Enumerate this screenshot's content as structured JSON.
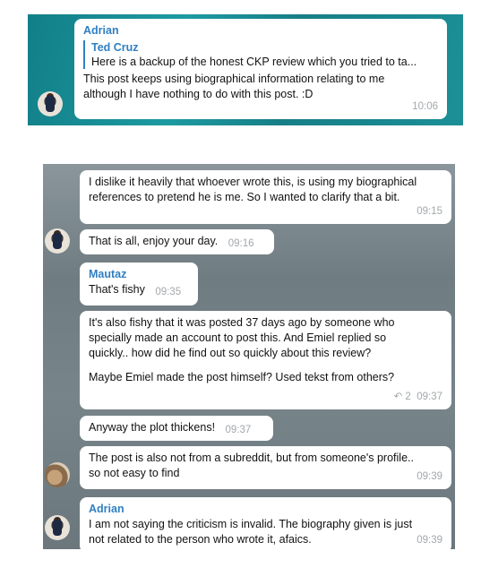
{
  "top": {
    "sender": "Adrian",
    "reply_name": "Ted Cruz",
    "reply_text": "Here is a backup of the honest CKP review which you tried to ta...",
    "text_line1": "This post keeps using biographical information relating to me",
    "text_line2": "although I have nothing to do with this post. :D",
    "time": "10:06"
  },
  "messages": [
    {
      "line1": "I dislike it heavily that whoever wrote this, is using my biographical",
      "line2": "references to pretend he is me. So I wanted to clarify that a bit.",
      "time": "09:15"
    },
    {
      "text": "That is all, enjoy your day.",
      "time": "09:16"
    },
    {
      "sender": "Mautaz",
      "text": "That's fishy",
      "time": "09:35"
    },
    {
      "line1": "It's also fishy that it was posted 37 days ago by someone who",
      "line2": "specially made an account to post this. And Emiel replied so",
      "line3": "quickly.. how did he find out so quickly about this review?",
      "line4": "Maybe Emiel made the post himself? Used tekst from others?",
      "forwards": "2",
      "time": "09:37"
    },
    {
      "text": "Anyway the plot thickens!",
      "time": "09:37"
    },
    {
      "line1": "The post is also not from a subreddit, but from someone's profile..",
      "line2": "so not easy to find",
      "time": "09:39"
    },
    {
      "sender": "Adrian",
      "line1": "I am not saying the criticism is invalid. The biography given is just",
      "line2": "not related to the person who wrote it, afaics.",
      "time": "09:39"
    }
  ]
}
